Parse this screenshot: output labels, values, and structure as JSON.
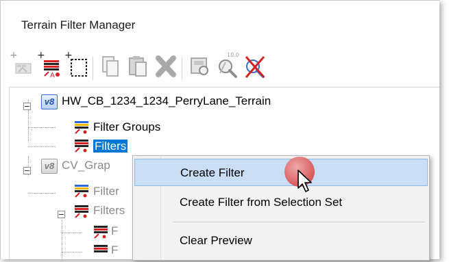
{
  "window": {
    "title": "Terrain Filter Manager"
  },
  "toolbar": {
    "buttons": [
      {
        "name": "add-terrain-icon",
        "enabled": false
      },
      {
        "name": "add-filter-group-icon",
        "enabled": true
      },
      {
        "name": "add-selection-icon",
        "enabled": true
      },
      {
        "name": "copy-icon",
        "enabled": false
      },
      {
        "name": "paste-icon",
        "enabled": false
      },
      {
        "name": "delete-icon",
        "enabled": false
      },
      {
        "name": "preview-icon",
        "enabled": false
      },
      {
        "name": "zoom-preview-icon",
        "enabled": false
      },
      {
        "name": "clear-preview-icon",
        "enabled": true
      }
    ]
  },
  "tree": {
    "root": "HW_CB_1234_1234_PerryLane_Terrain",
    "filter_groups": "Filter Groups",
    "filters": "Filters",
    "second_root": "CV_Grap",
    "second_filter_groups": "Filter",
    "second_filters": "Filters",
    "child_1": "F",
    "child_2": "F"
  },
  "context_menu": {
    "items": [
      "Create Filter",
      "Create Filter from Selection Set",
      "Clear Preview"
    ],
    "hover_index": 0
  },
  "colors": {
    "selection": "#0078d7",
    "menu_hover": "#c9def5",
    "cursor_indicator": "#d94f4f"
  }
}
